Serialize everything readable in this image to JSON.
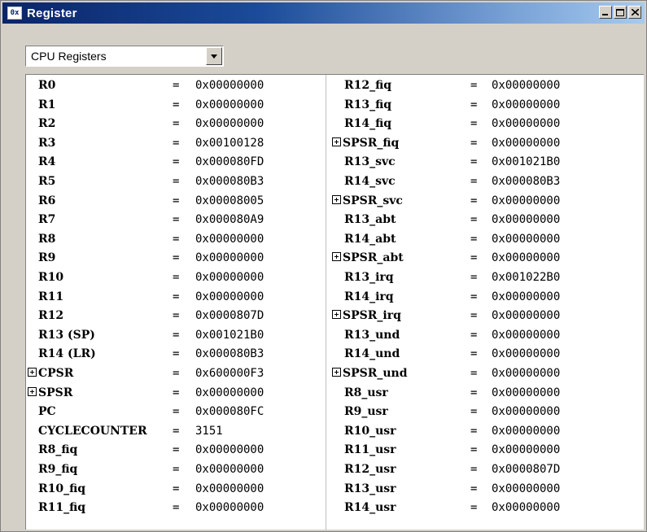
{
  "window": {
    "title": "Register",
    "icon_text": "0x"
  },
  "dropdown": {
    "selected": "CPU Registers"
  },
  "left_column": [
    {
      "name": "R0",
      "value": "0x00000000",
      "expandable": false
    },
    {
      "name": "R1",
      "value": "0x00000000",
      "expandable": false
    },
    {
      "name": "R2",
      "value": "0x00000000",
      "expandable": false
    },
    {
      "name": "R3",
      "value": "0x00100128",
      "expandable": false
    },
    {
      "name": "R4",
      "value": "0x000080FD",
      "expandable": false
    },
    {
      "name": "R5",
      "value": "0x000080B3",
      "expandable": false
    },
    {
      "name": "R6",
      "value": "0x00008005",
      "expandable": false
    },
    {
      "name": "R7",
      "value": "0x000080A9",
      "expandable": false
    },
    {
      "name": "R8",
      "value": "0x00000000",
      "expandable": false
    },
    {
      "name": "R9",
      "value": "0x00000000",
      "expandable": false
    },
    {
      "name": "R10",
      "value": "0x00000000",
      "expandable": false
    },
    {
      "name": "R11",
      "value": "0x00000000",
      "expandable": false
    },
    {
      "name": "R12",
      "value": "0x0000807D",
      "expandable": false
    },
    {
      "name": "R13 (SP)",
      "value": "0x001021B0",
      "expandable": false
    },
    {
      "name": "R14 (LR)",
      "value": "0x000080B3",
      "expandable": false
    },
    {
      "name": "CPSR",
      "value": "0x600000F3",
      "expandable": true
    },
    {
      "name": "SPSR",
      "value": "0x00000000",
      "expandable": true
    },
    {
      "name": "PC",
      "value": "0x000080FC",
      "expandable": false
    },
    {
      "name": "CYCLECOUNTER",
      "value": "3151",
      "expandable": false
    },
    {
      "name": "R8_fiq",
      "value": "0x00000000",
      "expandable": false
    },
    {
      "name": "R9_fiq",
      "value": "0x00000000",
      "expandable": false
    },
    {
      "name": "R10_fiq",
      "value": "0x00000000",
      "expandable": false
    },
    {
      "name": "R11_fiq",
      "value": "0x00000000",
      "expandable": false
    }
  ],
  "right_column": [
    {
      "name": "R12_fiq",
      "value": "0x00000000",
      "expandable": false
    },
    {
      "name": "R13_fiq",
      "value": "0x00000000",
      "expandable": false
    },
    {
      "name": "R14_fiq",
      "value": "0x00000000",
      "expandable": false
    },
    {
      "name": "SPSR_fiq",
      "value": "0x00000000",
      "expandable": true
    },
    {
      "name": "R13_svc",
      "value": "0x001021B0",
      "expandable": false
    },
    {
      "name": "R14_svc",
      "value": "0x000080B3",
      "expandable": false
    },
    {
      "name": "SPSR_svc",
      "value": "0x00000000",
      "expandable": true
    },
    {
      "name": "R13_abt",
      "value": "0x00000000",
      "expandable": false
    },
    {
      "name": "R14_abt",
      "value": "0x00000000",
      "expandable": false
    },
    {
      "name": "SPSR_abt",
      "value": "0x00000000",
      "expandable": true
    },
    {
      "name": "R13_irq",
      "value": "0x001022B0",
      "expandable": false
    },
    {
      "name": "R14_irq",
      "value": "0x00000000",
      "expandable": false
    },
    {
      "name": "SPSR_irq",
      "value": "0x00000000",
      "expandable": true
    },
    {
      "name": "R13_und",
      "value": "0x00000000",
      "expandable": false
    },
    {
      "name": "R14_und",
      "value": "0x00000000",
      "expandable": false
    },
    {
      "name": "SPSR_und",
      "value": "0x00000000",
      "expandable": true
    },
    {
      "name": "R8_usr",
      "value": "0x00000000",
      "expandable": false
    },
    {
      "name": "R9_usr",
      "value": "0x00000000",
      "expandable": false
    },
    {
      "name": "R10_usr",
      "value": "0x00000000",
      "expandable": false
    },
    {
      "name": "R11_usr",
      "value": "0x00000000",
      "expandable": false
    },
    {
      "name": "R12_usr",
      "value": "0x0000807D",
      "expandable": false
    },
    {
      "name": "R13_usr",
      "value": "0x00000000",
      "expandable": false
    },
    {
      "name": "R14_usr",
      "value": "0x00000000",
      "expandable": false
    }
  ],
  "equals_sign": "="
}
